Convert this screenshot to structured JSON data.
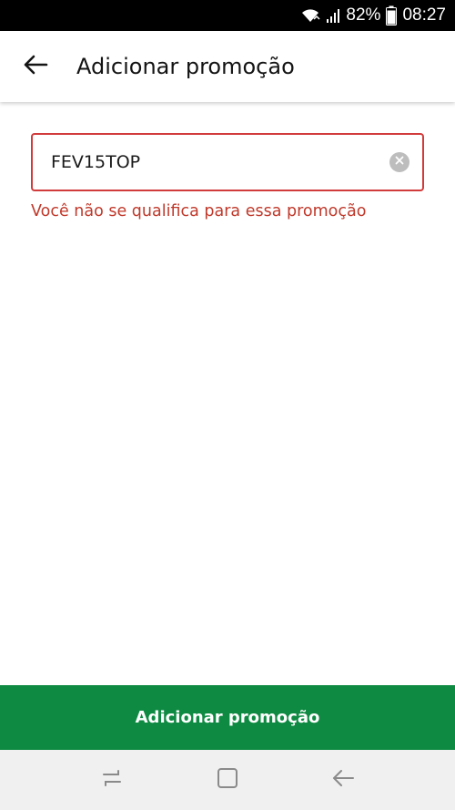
{
  "status_bar": {
    "battery_percent": "82%",
    "time": "08:27",
    "icons": [
      "wifi-icon",
      "signal-icon",
      "battery-icon"
    ]
  },
  "app_bar": {
    "title": "Adicionar promoção",
    "back_icon": "arrow-left-icon"
  },
  "promo_field": {
    "value": "FEV15TOP",
    "placeholder": "",
    "clear_icon": "clear-circle-icon",
    "error": "Você não se qualifica para essa promoção"
  },
  "cta": {
    "label": "Adicionar promoção"
  },
  "nav_bar": {
    "icons": [
      "recent-apps-icon",
      "home-icon",
      "back-icon"
    ]
  },
  "colors": {
    "accent_green": "#0e8a42",
    "error_red": "#c0392b",
    "field_border_error": "#d23b3b",
    "status_bar_bg": "#000000",
    "nav_bar_bg": "#f0f0f0"
  }
}
